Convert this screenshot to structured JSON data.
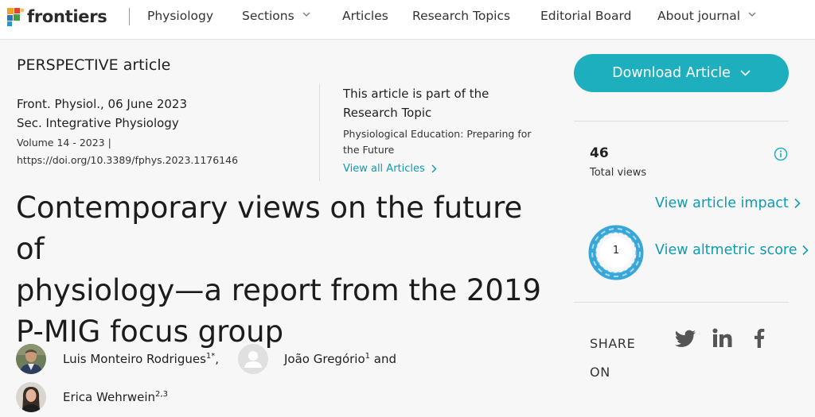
{
  "nav": {
    "logo_text": "frontiers",
    "items": [
      {
        "label": "Physiology",
        "dropdown": false
      },
      {
        "label": "Sections",
        "dropdown": true
      },
      {
        "label": "Articles",
        "dropdown": false
      },
      {
        "label": "Research Topics",
        "dropdown": false
      },
      {
        "label": "Editorial Board",
        "dropdown": false
      },
      {
        "label": "About journal",
        "dropdown": true
      }
    ]
  },
  "article": {
    "type": "PERSPECTIVE article",
    "journal_date": "Front. Physiol., 06 June 2023",
    "section": "Sec. Integrative Physiology",
    "volume": "Volume 14 - 2023 |",
    "doi": "https://doi.org/10.3389/fphys.2023.1176146",
    "title_lines": [
      "Contemporary views on the future of",
      "physiology—a report from the 2019",
      "P-MIG focus group"
    ]
  },
  "research_topic": {
    "heading": "This article is part of the Research Topic",
    "title": "Physiological Education: Preparing for the Future",
    "link": "View all Articles"
  },
  "authors": [
    {
      "name": "Luis Monteiro Rodrigues",
      "sup": "1*",
      "suffix": ","
    },
    {
      "name": "João Gregório",
      "sup": "1",
      "suffix": " and"
    },
    {
      "name": "Erica Wehrwein",
      "sup": "2,3",
      "suffix": ""
    }
  ],
  "sidebar": {
    "download_label": "Download Article",
    "views_count": "46",
    "views_label": "Total views",
    "impact_link": "View article impact",
    "altmetric_score": "1",
    "altmetric_link": "View altmetric score",
    "share_label": "SHARE ON",
    "share_icons": [
      "twitter-icon",
      "linkedin-icon",
      "facebook-icon"
    ]
  },
  "colors": {
    "accent": "#1eafbf",
    "link": "#0f9bb2",
    "altmetric": "#39a6d8"
  }
}
